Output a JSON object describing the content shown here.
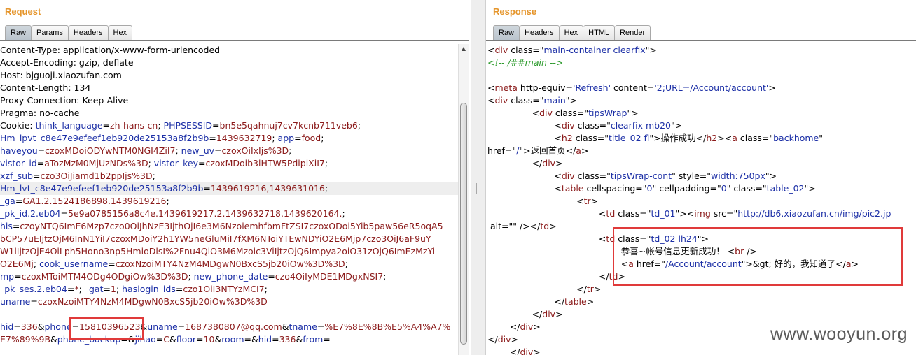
{
  "request": {
    "title": "Request",
    "tabs": [
      "Raw",
      "Params",
      "Headers",
      "Hex"
    ],
    "active_tab": "Raw",
    "lines": [
      [
        [
          "k",
          "Content-Type: application/x-www-form-urlencoded"
        ]
      ],
      [
        [
          "k",
          "Accept-Encoding: gzip, deflate"
        ]
      ],
      [
        [
          "k",
          "Host: bjguoji.xiaozufan.com"
        ]
      ],
      [
        [
          "k",
          "Content-Length: 134"
        ]
      ],
      [
        [
          "k",
          "Proxy-Connection: Keep-Alive"
        ]
      ],
      [
        [
          "k",
          "Pragma: no-cache"
        ]
      ],
      [
        [
          "k",
          "Cookie: "
        ],
        [
          "b",
          "think_language"
        ],
        [
          "k",
          "="
        ],
        [
          "r",
          "zh-hans-cn"
        ],
        [
          "k",
          "; "
        ],
        [
          "b",
          "PHPSESSID"
        ],
        [
          "k",
          "="
        ],
        [
          "r",
          "bn5e5qahnuj7cv7kcnb711veb6"
        ],
        [
          "k",
          ";"
        ]
      ],
      [
        [
          "b",
          "Hm_lpvt_c8e47e9efeef1eb920de25153a8f2b9b"
        ],
        [
          "k",
          "="
        ],
        [
          "r",
          "1439632719"
        ],
        [
          "k",
          "; "
        ],
        [
          "b",
          "app"
        ],
        [
          "k",
          "="
        ],
        [
          "r",
          "food"
        ],
        [
          "k",
          ";"
        ]
      ],
      [
        [
          "b",
          "haveyou"
        ],
        [
          "k",
          "="
        ],
        [
          "r",
          "czoxMDoiODYwNTM0NGI4ZiI7"
        ],
        [
          "k",
          "; "
        ],
        [
          "b",
          "new_uv"
        ],
        [
          "k",
          "="
        ],
        [
          "r",
          "czoxOiIxIjs%3D"
        ],
        [
          "k",
          ";"
        ]
      ],
      [
        [
          "b",
          "vistor_id"
        ],
        [
          "k",
          "="
        ],
        [
          "r",
          "aTozMzM0MjUzNDs%3D"
        ],
        [
          "k",
          "; "
        ],
        [
          "b",
          "vistor_key"
        ],
        [
          "k",
          "="
        ],
        [
          "r",
          "czoxMDoib3lHTW5PdipiXiI7"
        ],
        [
          "k",
          ";"
        ]
      ],
      [
        [
          "b",
          "xzf_sub"
        ],
        [
          "k",
          "="
        ],
        [
          "r",
          "czo3OiJiamd1b2ppIjs%3D"
        ],
        [
          "k",
          ";"
        ]
      ],
      [
        [
          "b",
          "Hm_lvt_c8e47e9efeef1eb920de25153a8f2b9b"
        ],
        [
          "k",
          "="
        ],
        [
          "r",
          "1439619216,1439631016"
        ],
        [
          "k",
          ";"
        ]
      ],
      [
        [
          "b",
          "_ga"
        ],
        [
          "k",
          "="
        ],
        [
          "r",
          "GA1.2.1524186898.1439619216"
        ],
        [
          "k",
          ";"
        ]
      ],
      [
        [
          "b",
          "_pk_id.2.eb04"
        ],
        [
          "k",
          "="
        ],
        [
          "r",
          "5e9a0785156a8c4e.1439619217.2.1439632718.1439620164."
        ],
        [
          "k",
          ";"
        ]
      ],
      [
        [
          "b",
          "his"
        ],
        [
          "k",
          "="
        ],
        [
          "r",
          "czoyNTQ6ImE6Mzp7czo0OiJhNzE3IjthOjI6e3M6NzoiemhfbmFtZSI7czoxODoi5Yib5paw56eR5oqA5"
        ]
      ],
      [
        [
          "r",
          "bCP57uEIjtzOjM6InN1YiI7czoxMDoiY2h1YW5neGluMiI7fXM6NToiYTEwNDYiO2E6Mjp7czo3OiJ6aF9uY"
        ]
      ],
      [
        [
          "r",
          "W1lIjtzOjE4OiLph5Hono3np5HmioDlsI%2Fnu4QiO3M6Mzoic3ViIjtzOjQ6Impya2oiO31zOjQ6ImEzMzYi"
        ]
      ],
      [
        [
          "r",
          "O2E6Mj"
        ],
        [
          "k",
          "; "
        ],
        [
          "b",
          "cook_username"
        ],
        [
          "k",
          "="
        ],
        [
          "r",
          "czoxNzoiMTY4NzM4MDgwN0BxcS5jb20iOw%3D%3D"
        ],
        [
          "k",
          ";"
        ]
      ],
      [
        [
          "b",
          "mp"
        ],
        [
          "k",
          "="
        ],
        [
          "r",
          "czoxMToiMTM4ODg4ODgiOw%3D%3D"
        ],
        [
          "k",
          "; "
        ],
        [
          "b",
          "new_phone_date"
        ],
        [
          "k",
          "="
        ],
        [
          "r",
          "czo4OiIyMDE1MDgxNSI7"
        ],
        [
          "k",
          ";"
        ]
      ],
      [
        [
          "b",
          "_pk_ses.2.eb04"
        ],
        [
          "k",
          "="
        ],
        [
          "r",
          "*"
        ],
        [
          "k",
          "; "
        ],
        [
          "b",
          "_gat"
        ],
        [
          "k",
          "="
        ],
        [
          "r",
          "1"
        ],
        [
          "k",
          "; "
        ],
        [
          "b",
          "haslogin_ids"
        ],
        [
          "k",
          "="
        ],
        [
          "r",
          "czo1OiI3NTYzMCI7"
        ],
        [
          "k",
          ";"
        ]
      ],
      [
        [
          "b",
          "uname"
        ],
        [
          "k",
          "="
        ],
        [
          "r",
          "czoxNzoiMTY4NzM4MDgwN0BxcS5jb20iOw%3D%3D"
        ]
      ],
      [
        [
          "k",
          " "
        ]
      ],
      [
        [
          "b",
          "hid"
        ],
        [
          "k",
          "="
        ],
        [
          "r",
          "336"
        ],
        [
          "k",
          "&"
        ],
        [
          "b",
          "phone"
        ],
        [
          "k",
          "="
        ],
        [
          "r",
          "15810396523"
        ],
        [
          "k",
          "&"
        ],
        [
          "b",
          "uname"
        ],
        [
          "k",
          "="
        ],
        [
          "r",
          "1687380807@qq.com"
        ],
        [
          "k",
          "&"
        ],
        [
          "b",
          "tname"
        ],
        [
          "k",
          "="
        ],
        [
          "r",
          "%E7%8E%8B%E5%A4%A7%"
        ]
      ],
      [
        [
          "r",
          "E7%89%9B"
        ],
        [
          "k",
          "&"
        ],
        [
          "b",
          "phone_backup"
        ],
        [
          "k",
          "=&"
        ],
        [
          "b",
          "jihao"
        ],
        [
          "k",
          "="
        ],
        [
          "r",
          "C"
        ],
        [
          "k",
          "&"
        ],
        [
          "b",
          "floor"
        ],
        [
          "k",
          "="
        ],
        [
          "r",
          "10"
        ],
        [
          "k",
          "&"
        ],
        [
          "b",
          "room"
        ],
        [
          "k",
          "=&"
        ],
        [
          "b",
          "hid"
        ],
        [
          "k",
          "="
        ],
        [
          "r",
          "336"
        ],
        [
          "k",
          "&"
        ],
        [
          "b",
          "from"
        ],
        [
          "k",
          "="
        ]
      ]
    ]
  },
  "response": {
    "title": "Response",
    "tabs": [
      "Raw",
      "Headers",
      "Hex",
      "HTML",
      "Render"
    ],
    "active_tab": "Raw",
    "lines": [
      [
        [
          "k",
          "<"
        ],
        [
          "r",
          "div"
        ],
        [
          "k",
          " "
        ],
        [
          "k",
          "class="
        ],
        [
          "k",
          "\""
        ],
        [
          "b",
          "main-container clearfix"
        ],
        [
          "k",
          "\">"
        ]
      ],
      [
        [
          "g",
          "<!-- /##main -->"
        ]
      ],
      [
        [
          "k",
          " "
        ]
      ],
      [
        [
          "k",
          "<"
        ],
        [
          "r",
          "meta"
        ],
        [
          "k",
          " http-equiv="
        ],
        [
          "b",
          "'Refresh'"
        ],
        [
          "k",
          " content="
        ],
        [
          "b",
          "'2;URL=/Account/account'"
        ],
        [
          "k",
          ">"
        ]
      ],
      [
        [
          "k",
          "<"
        ],
        [
          "r",
          "div"
        ],
        [
          "k",
          " class="
        ],
        [
          "k",
          "\""
        ],
        [
          "b",
          "main"
        ],
        [
          "k",
          "\">"
        ]
      ],
      [
        [
          "k",
          "                <"
        ],
        [
          "r",
          "div"
        ],
        [
          "k",
          " class="
        ],
        [
          "k",
          "\""
        ],
        [
          "b",
          "tipsWrap"
        ],
        [
          "k",
          "\">"
        ]
      ],
      [
        [
          "k",
          "                        <"
        ],
        [
          "r",
          "div"
        ],
        [
          "k",
          " class="
        ],
        [
          "k",
          "\""
        ],
        [
          "b",
          "clearfix mb20"
        ],
        [
          "k",
          "\">"
        ]
      ],
      [
        [
          "k",
          "                        <"
        ],
        [
          "r",
          "h2"
        ],
        [
          "k",
          " class="
        ],
        [
          "k",
          "\""
        ],
        [
          "b",
          "title_02 fl"
        ],
        [
          "k",
          "\">"
        ],
        [
          "k",
          "操作成功"
        ],
        [
          "k",
          "</"
        ],
        [
          "r",
          "h2"
        ],
        [
          "k",
          "><"
        ],
        [
          "r",
          "a"
        ],
        [
          "k",
          " class="
        ],
        [
          "k",
          "\""
        ],
        [
          "b",
          "backhome"
        ],
        [
          "k",
          "\""
        ]
      ],
      [
        [
          "k",
          "href="
        ],
        [
          "k",
          "\""
        ],
        [
          "b",
          "/"
        ],
        [
          "k",
          "\">"
        ],
        [
          "k",
          "返回首页"
        ],
        [
          "k",
          "</"
        ],
        [
          "r",
          "a"
        ],
        [
          "k",
          ">"
        ]
      ],
      [
        [
          "k",
          "                </"
        ],
        [
          "r",
          "div"
        ],
        [
          "k",
          ">"
        ]
      ],
      [
        [
          "k",
          "                        <"
        ],
        [
          "r",
          "div"
        ],
        [
          "k",
          " class="
        ],
        [
          "k",
          "\""
        ],
        [
          "b",
          "tipsWrap-cont"
        ],
        [
          "k",
          "\""
        ],
        [
          "k",
          " style="
        ],
        [
          "k",
          "\""
        ],
        [
          "b",
          "width:750px"
        ],
        [
          "k",
          "\">"
        ]
      ],
      [
        [
          "k",
          "                        <"
        ],
        [
          "r",
          "table"
        ],
        [
          "k",
          " cellspacing="
        ],
        [
          "k",
          "\""
        ],
        [
          "b",
          "0"
        ],
        [
          "k",
          "\""
        ],
        [
          "k",
          " cellpadding="
        ],
        [
          "k",
          "\""
        ],
        [
          "b",
          "0"
        ],
        [
          "k",
          "\""
        ],
        [
          "k",
          " class="
        ],
        [
          "k",
          "\""
        ],
        [
          "b",
          "table_02"
        ],
        [
          "k",
          "\">"
        ]
      ],
      [
        [
          "k",
          "                                <"
        ],
        [
          "r",
          "tr"
        ],
        [
          "k",
          ">"
        ]
      ],
      [
        [
          "k",
          "                                        <"
        ],
        [
          "r",
          "td"
        ],
        [
          "k",
          " class="
        ],
        [
          "k",
          "\""
        ],
        [
          "b",
          "td_01"
        ],
        [
          "k",
          "\"><"
        ],
        [
          "r",
          "img"
        ],
        [
          "k",
          " src="
        ],
        [
          "k",
          "\""
        ],
        [
          "b",
          "http://db6.xiaozufan.cn/img/pic2.jp"
        ]
      ],
      [
        [
          "k",
          " alt="
        ],
        [
          "k",
          "\""
        ],
        [
          "b",
          ""
        ],
        [
          "k",
          "\""
        ],
        [
          "k",
          " /></"
        ],
        [
          "r",
          "td"
        ],
        [
          "k",
          ">"
        ]
      ],
      [
        [
          "k",
          "                                        <"
        ],
        [
          "r",
          "td"
        ],
        [
          "k",
          " class="
        ],
        [
          "k",
          "\""
        ],
        [
          "b",
          "td_02 lh24"
        ],
        [
          "k",
          "\">"
        ]
      ],
      [
        [
          "k",
          "                                                恭喜~帐号信息更新成功！ <"
        ],
        [
          "r",
          "br"
        ],
        [
          "k",
          " />"
        ]
      ],
      [
        [
          "k",
          "                                                <"
        ],
        [
          "r",
          "a"
        ],
        [
          "k",
          " href="
        ],
        [
          "k",
          "\""
        ],
        [
          "b",
          "/Account/account"
        ],
        [
          "k",
          "\">"
        ],
        [
          "k",
          "&gt; 好的，我知道了"
        ],
        [
          "k",
          "</"
        ],
        [
          "r",
          "a"
        ],
        [
          "k",
          ">"
        ]
      ],
      [
        [
          "k",
          "                                        </"
        ],
        [
          "r",
          "td"
        ],
        [
          "k",
          ">"
        ]
      ],
      [
        [
          "k",
          "                                </"
        ],
        [
          "r",
          "tr"
        ],
        [
          "k",
          ">"
        ]
      ],
      [
        [
          "k",
          "                        </"
        ],
        [
          "r",
          "table"
        ],
        [
          "k",
          ">"
        ]
      ],
      [
        [
          "k",
          "                </"
        ],
        [
          "r",
          "div"
        ],
        [
          "k",
          ">"
        ]
      ],
      [
        [
          "k",
          "        </"
        ],
        [
          "r",
          "div"
        ],
        [
          "k",
          ">"
        ]
      ],
      [
        [
          "k",
          "</"
        ],
        [
          "r",
          "div"
        ],
        [
          "k",
          ">"
        ]
      ],
      [
        [
          "k",
          "        </"
        ],
        [
          "r",
          "div"
        ],
        [
          "k",
          ">"
        ]
      ]
    ]
  },
  "watermark": "www.wooyun.org"
}
